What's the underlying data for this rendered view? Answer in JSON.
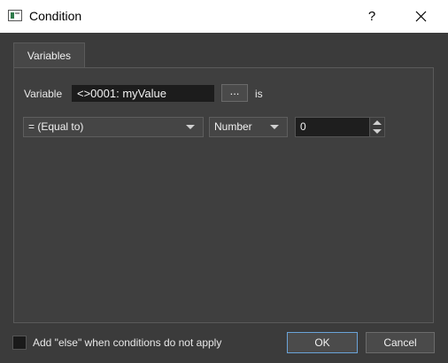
{
  "window": {
    "title": "Condition",
    "help_label": "?"
  },
  "tabs": [
    {
      "label": "Variables",
      "active": true
    }
  ],
  "variable_row": {
    "label": "Variable",
    "value": "<>0001: myValue",
    "browse_label": "...",
    "suffix": "is"
  },
  "comparison_row": {
    "operator": "= (Equal to)",
    "type": "Number",
    "number_value": "0"
  },
  "footer": {
    "else_checkbox_label": "Add \"else\" when conditions do not apply",
    "else_checked": false,
    "ok_label": "OK",
    "cancel_label": "Cancel"
  },
  "colors": {
    "background": "#3b3b3b",
    "panel": "#3f3f3f",
    "field_dark": "#1c1c1c",
    "ok_focus_border": "#6aa3d8"
  },
  "icons": {
    "app": "app-window-icon",
    "close": "close-icon",
    "dropdown": "chevron-down-icon",
    "spin_up": "arrow-up-icon",
    "spin_down": "arrow-down-icon"
  }
}
